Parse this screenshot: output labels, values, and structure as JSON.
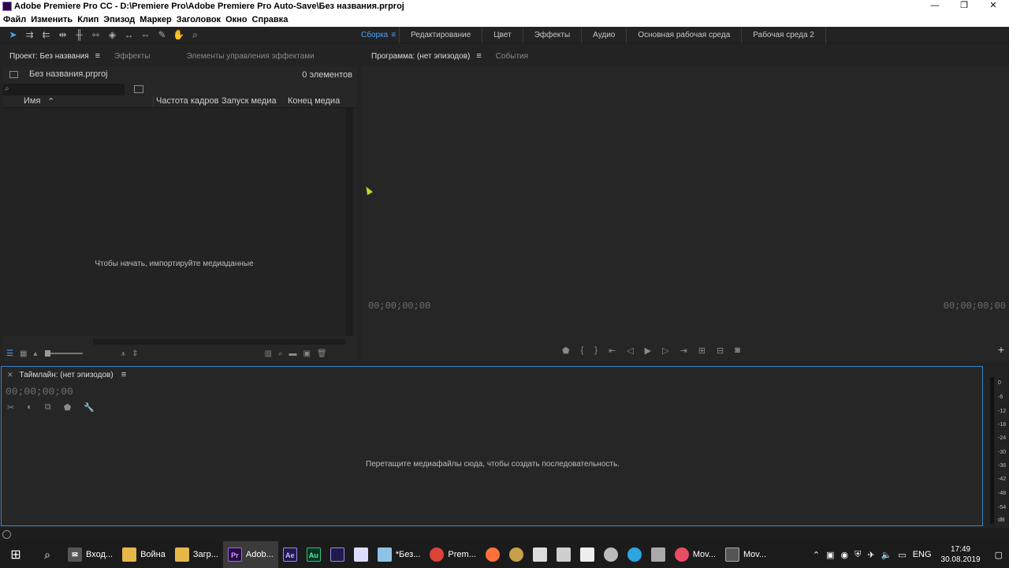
{
  "window": {
    "title": "Adobe Premiere Pro CC - D:\\Premiere Pro\\Adobe Premiere Pro Auto-Save\\Без названия.prproj",
    "minimize": "—",
    "maximize": "❐",
    "close": "✕"
  },
  "menu": [
    "Файл",
    "Изменить",
    "Клип",
    "Эпизод",
    "Маркер",
    "Заголовок",
    "Окно",
    "Справка"
  ],
  "tools": [
    "selection-tool",
    "track-select-forward-tool",
    "track-select-backward-tool",
    "ripple-edit-tool",
    "rolling-edit-tool",
    "rate-stretch-tool",
    "razor-tool",
    "slip-tool",
    "slide-tool",
    "pen-tool",
    "hand-tool",
    "zoom-tool"
  ],
  "workspaces": {
    "active": "Сборка",
    "items": [
      "Редактирование",
      "Цвет",
      "Эффекты",
      "Аудио",
      "Основная рабочая среда",
      "Рабочая среда 2"
    ]
  },
  "project": {
    "tabs": {
      "project": "Проект: Без названия",
      "effects": "Эффекты",
      "effect_controls": "Элементы управления эффектами"
    },
    "file_name": "Без названия.prproj",
    "item_count": "0 элементов",
    "columns": {
      "name": "Имя",
      "frame_rate": "Частота кадров",
      "media_start": "Запуск медиа",
      "media_end": "Конец медиа"
    },
    "empty_hint": "Чтобы начать, импортируйте медиаданные"
  },
  "program": {
    "tabs": {
      "program": "Программа: (нет эпизодов)",
      "events": "События"
    },
    "timecode_in": "00;00;00;00",
    "timecode_out": "00;00;00;00"
  },
  "timeline": {
    "tab": "Таймлайн: (нет эпизодов)",
    "timecode": "00;00;00;00",
    "hint": "Перетащите медиафайлы сюда, чтобы создать последовательность."
  },
  "audio_meter": {
    "labels": [
      "0",
      "-6",
      "-12",
      "-18",
      "-24",
      "-30",
      "-36",
      "-42",
      "-48",
      "-54",
      "dB"
    ]
  },
  "taskbar": {
    "items": [
      {
        "label": "Вход...",
        "icon": "mail-icon"
      },
      {
        "label": "Война",
        "icon": "folder-icon"
      },
      {
        "label": "Загр...",
        "icon": "folder-icon"
      },
      {
        "label": "Adob...",
        "icon": "premiere-icon"
      },
      {
        "label": "",
        "icon": "after-effects-icon"
      },
      {
        "label": "",
        "icon": "audition-icon"
      },
      {
        "label": "",
        "icon": "media-encoder-icon"
      },
      {
        "label": "",
        "icon": "document-icon"
      },
      {
        "label": "*Без...",
        "icon": "notepad-icon"
      },
      {
        "label": "Prem...",
        "icon": "chrome-icon"
      },
      {
        "label": "Mov...",
        "icon": "movavi-icon"
      },
      {
        "label": "Mov...",
        "icon": "movavi-video-icon"
      }
    ],
    "language": "ENG",
    "time": "17:49",
    "date": "30.08.2019"
  },
  "colors": {
    "accent": "#4aa3ff",
    "timeline_border": "#3a84c8",
    "premiere": "#2a0a45",
    "after_effects": "#1f1a4d",
    "audition": "#00361f"
  }
}
